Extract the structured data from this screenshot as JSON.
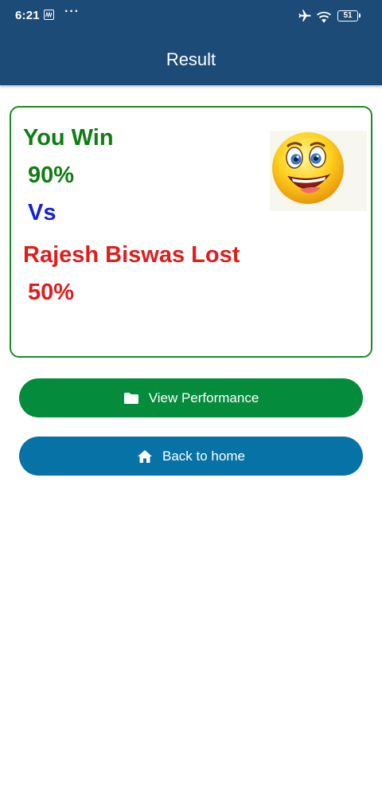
{
  "status_bar": {
    "time": "6:21",
    "more": "···",
    "battery_level": "51",
    "icons": [
      "app-notification-icon",
      "airplane-icon",
      "wifi-icon",
      "battery-icon"
    ]
  },
  "app_bar": {
    "title": "Result"
  },
  "result": {
    "win_label": "You Win",
    "win_percent": "90%",
    "vs_label": "Vs",
    "lost_label": "Rajesh Biswas Lost",
    "lost_percent": "50%",
    "image": "smiley-emoji"
  },
  "buttons": {
    "view_performance": {
      "label": "View Performance",
      "icon": "folder-icon"
    },
    "back_home": {
      "label": "Back to home",
      "icon": "home-icon"
    }
  },
  "colors": {
    "header": "#1c4b78",
    "card_border": "#1d8a2a",
    "win_text": "#0f7d12",
    "vs_text": "#1520d8",
    "lost_text": "#e01d1d",
    "performance_button": "#048c3c",
    "home_button": "#0672a6"
  }
}
